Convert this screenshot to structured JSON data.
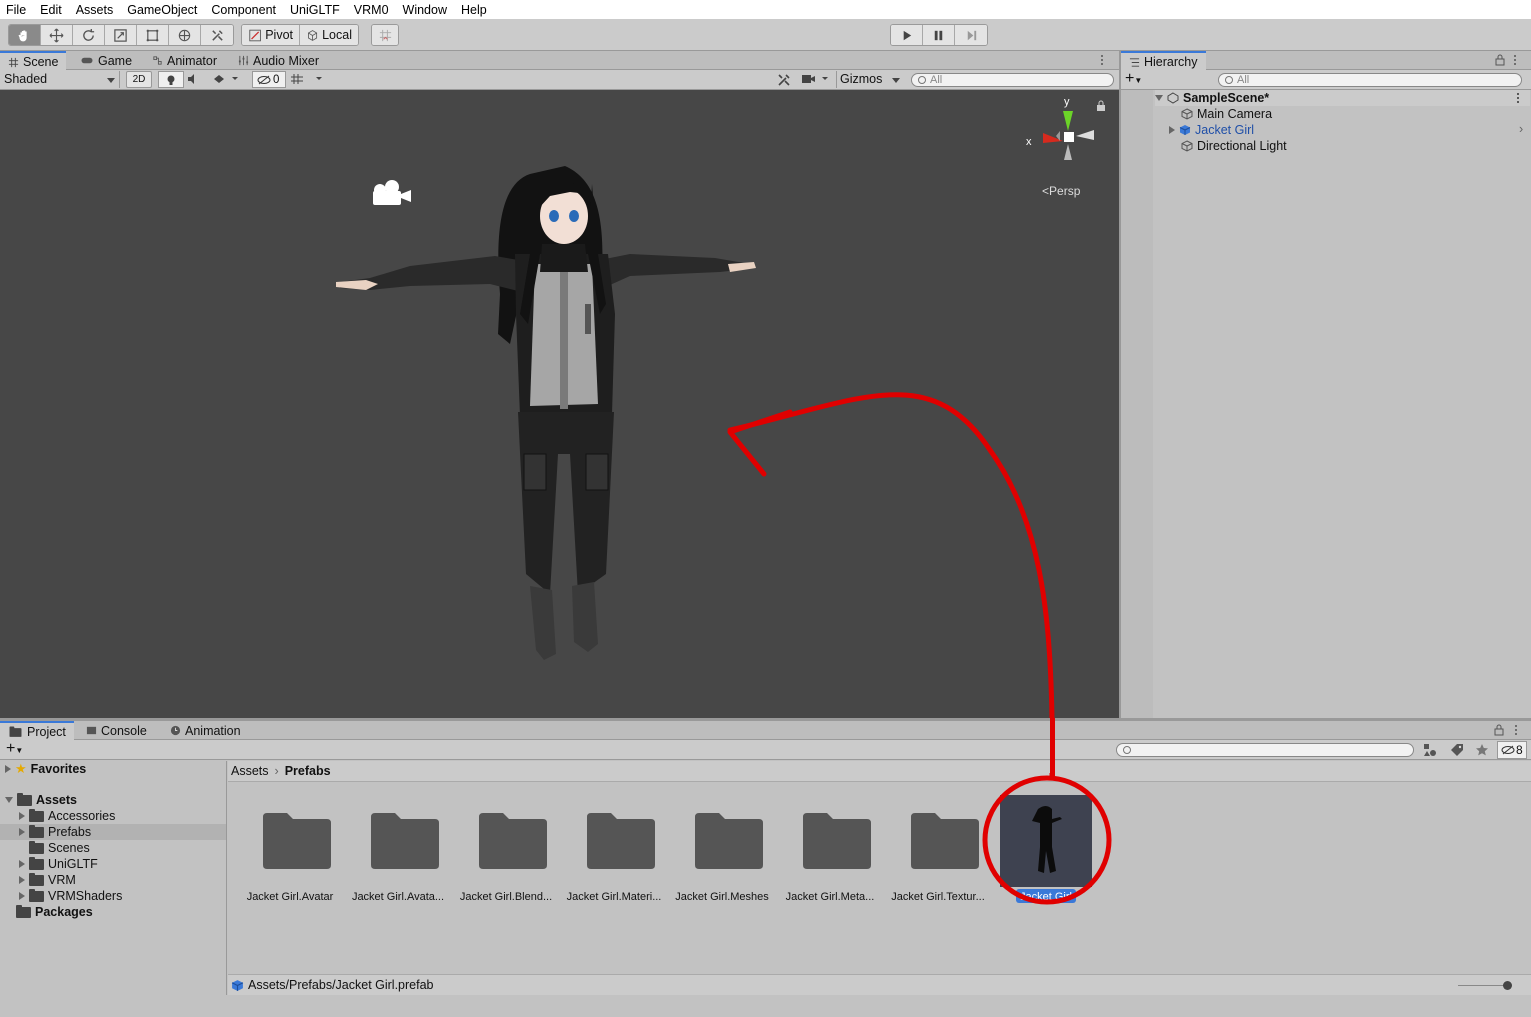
{
  "menu": [
    "File",
    "Edit",
    "Assets",
    "GameObject",
    "Component",
    "UniGLTF",
    "VRM0",
    "Window",
    "Help"
  ],
  "toolbar": {
    "pivot_label": "Pivot",
    "local_label": "Local"
  },
  "scene_tabs": [
    {
      "label": "Scene",
      "icon": "hash-icon",
      "active": true
    },
    {
      "label": "Game",
      "icon": "gamepad-icon",
      "active": false
    },
    {
      "label": "Animator",
      "icon": "animator-icon",
      "active": false
    },
    {
      "label": "Audio Mixer",
      "icon": "mixer-icon",
      "active": false
    }
  ],
  "scene_toolbar": {
    "shading_mode": "Shaded",
    "mode_2d": "2D",
    "hidden_count": "0",
    "gizmos_label": "Gizmos",
    "search_placeholder": "All"
  },
  "scene_view": {
    "gizmo_y": "y",
    "gizmo_x": "x",
    "projection": "Persp"
  },
  "hierarchy": {
    "tab_label": "Hierarchy",
    "search_placeholder": "All",
    "scene_name": "SampleScene*",
    "items": [
      {
        "label": "Main Camera",
        "selected": false,
        "expandable": false
      },
      {
        "label": "Jacket Girl",
        "selected": true,
        "expandable": true
      },
      {
        "label": "Directional Light",
        "selected": false,
        "expandable": false
      }
    ]
  },
  "project_tabs": [
    {
      "label": "Project",
      "icon": "folder-icon",
      "active": true
    },
    {
      "label": "Console",
      "icon": "console-icon",
      "active": false
    },
    {
      "label": "Animation",
      "icon": "clock-icon",
      "active": false
    }
  ],
  "project": {
    "hidden_count": "8",
    "favorites_label": "Favorites",
    "assets_label": "Assets",
    "asset_folders": [
      "Accessories",
      "Prefabs",
      "Scenes",
      "UniGLTF",
      "VRM",
      "VRMShaders"
    ],
    "packages_label": "Packages",
    "breadcrumb": [
      "Assets",
      "Prefabs"
    ],
    "items": [
      {
        "label": "Jacket Girl.Avatar",
        "type": "folder"
      },
      {
        "label": "Jacket Girl.Avata...",
        "type": "folder"
      },
      {
        "label": "Jacket Girl.Blend...",
        "type": "folder"
      },
      {
        "label": "Jacket Girl.Materi...",
        "type": "folder"
      },
      {
        "label": "Jacket Girl.Meshes",
        "type": "folder"
      },
      {
        "label": "Jacket Girl.Meta...",
        "type": "folder"
      },
      {
        "label": "Jacket Girl.Textur...",
        "type": "folder"
      },
      {
        "label": "Jacket Girl",
        "type": "prefab"
      }
    ],
    "status_path": "Assets/Prefabs/Jacket Girl.prefab"
  },
  "colors": {
    "annotation": "#e00000",
    "selection": "#3a79d8",
    "scene_bg": "#474747"
  }
}
